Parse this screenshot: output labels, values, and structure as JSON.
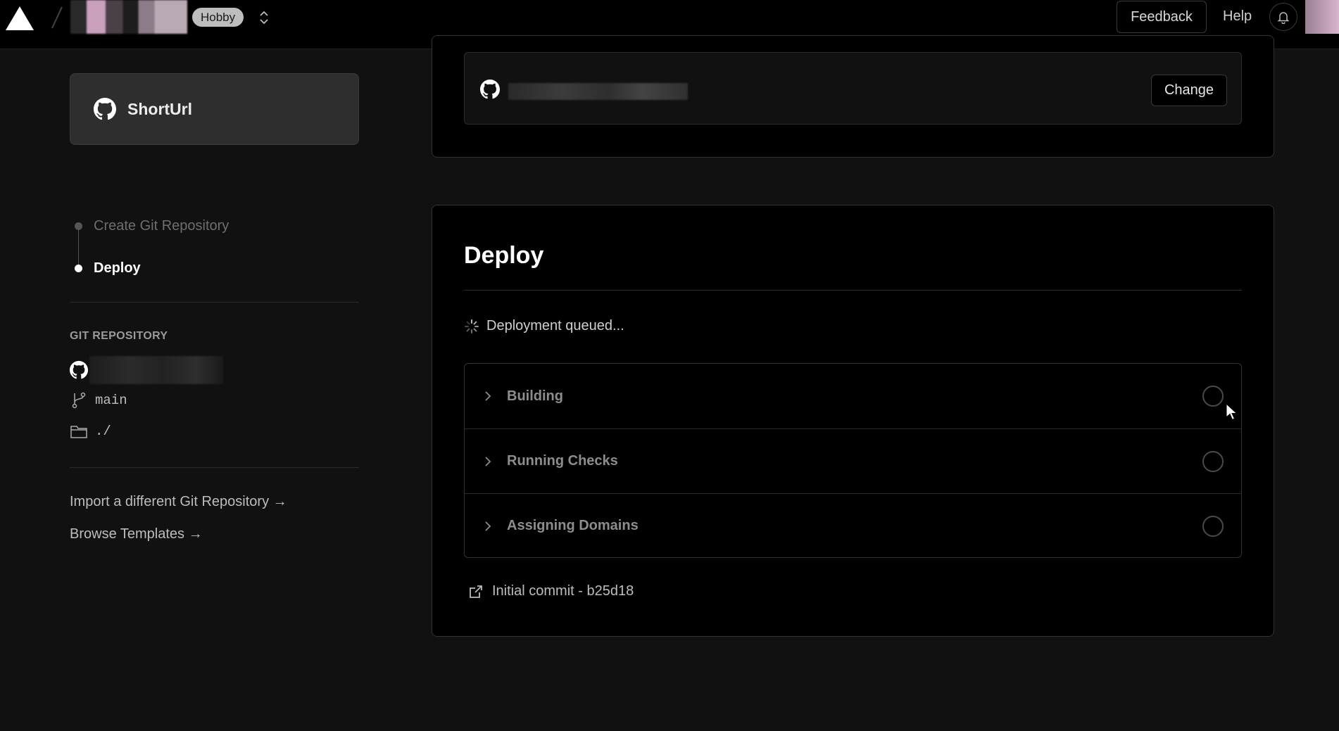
{
  "header": {
    "plan_badge": "Hobby",
    "feedback_label": "Feedback",
    "help_label": "Help"
  },
  "sidebar": {
    "project_name": "ShortUrl",
    "steps": [
      {
        "label": "Create Git Repository",
        "state": "complete"
      },
      {
        "label": "Deploy",
        "state": "active"
      }
    ],
    "git_heading": "GIT REPOSITORY",
    "branch": "main",
    "root_dir": "./",
    "links": [
      {
        "label": "Import a different Git Repository →"
      },
      {
        "label": "Browse Templates →"
      }
    ]
  },
  "repo_card": {
    "change_label": "Change"
  },
  "deploy": {
    "title": "Deploy",
    "status": "Deployment queued...",
    "phases": [
      {
        "label": "Building"
      },
      {
        "label": "Running Checks"
      },
      {
        "label": "Assigning Domains"
      }
    ],
    "commit": "Initial commit - b25d18"
  },
  "icons": {
    "logo": "triangle-logo-icon",
    "switcher": "chevron-up-down-icon",
    "bell": "bell-icon",
    "github": "github-icon",
    "branch": "git-branch-icon",
    "folder": "folder-icon",
    "spinner": "spinner-icon",
    "chevron": "chevron-right-icon",
    "external": "external-link-icon"
  },
  "colors": {
    "background": "#111111",
    "surface": "#000000",
    "accent_text": "#ffffff"
  }
}
